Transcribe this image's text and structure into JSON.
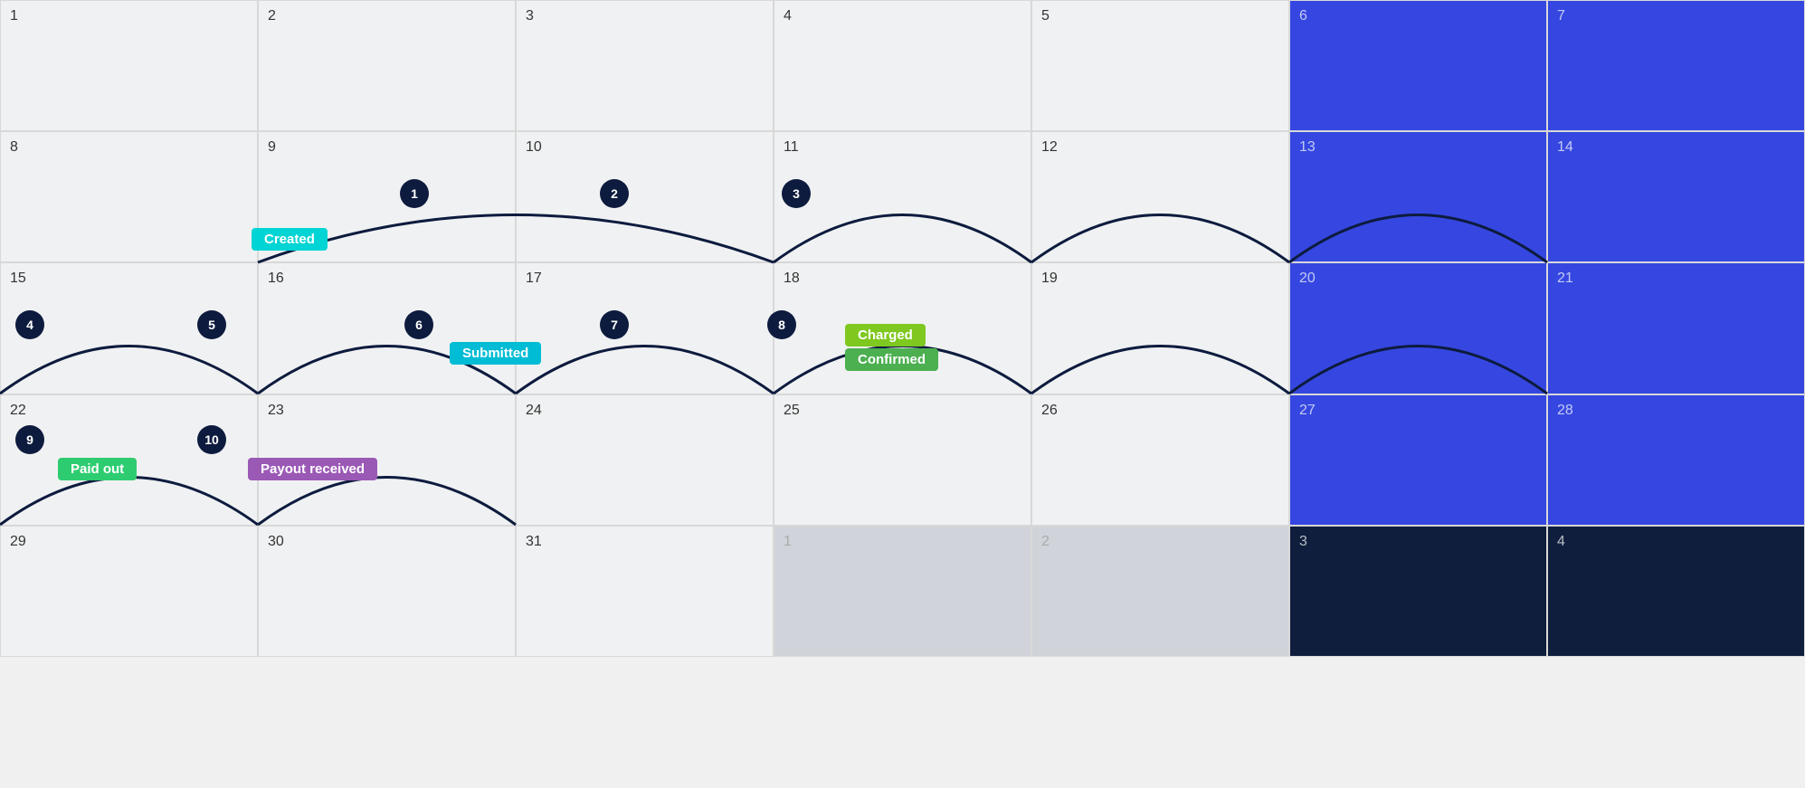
{
  "calendar": {
    "cells": [
      {
        "day": "1",
        "style": "normal",
        "col": 1,
        "row": 1
      },
      {
        "day": "2",
        "style": "normal",
        "col": 2,
        "row": 1
      },
      {
        "day": "3",
        "style": "normal",
        "col": 3,
        "row": 1
      },
      {
        "day": "4",
        "style": "normal",
        "col": 4,
        "row": 1
      },
      {
        "day": "5",
        "style": "normal",
        "col": 5,
        "row": 1
      },
      {
        "day": "6",
        "style": "blue-light",
        "col": 6,
        "row": 1
      },
      {
        "day": "7",
        "style": "blue-light",
        "col": 7,
        "row": 1
      },
      {
        "day": "8",
        "style": "normal",
        "col": 1,
        "row": 2
      },
      {
        "day": "9",
        "style": "normal",
        "col": 2,
        "row": 2
      },
      {
        "day": "10",
        "style": "normal",
        "col": 3,
        "row": 2
      },
      {
        "day": "11",
        "style": "normal",
        "col": 4,
        "row": 2
      },
      {
        "day": "12",
        "style": "normal",
        "col": 5,
        "row": 2
      },
      {
        "day": "13",
        "style": "blue-light",
        "col": 6,
        "row": 2
      },
      {
        "day": "14",
        "style": "blue-light",
        "col": 7,
        "row": 2
      },
      {
        "day": "15",
        "style": "normal",
        "col": 1,
        "row": 3
      },
      {
        "day": "16",
        "style": "normal",
        "col": 2,
        "row": 3
      },
      {
        "day": "17",
        "style": "normal",
        "col": 3,
        "row": 3
      },
      {
        "day": "18",
        "style": "normal",
        "col": 4,
        "row": 3
      },
      {
        "day": "19",
        "style": "normal",
        "col": 5,
        "row": 3
      },
      {
        "day": "20",
        "style": "blue-light",
        "col": 6,
        "row": 3
      },
      {
        "day": "21",
        "style": "blue-light",
        "col": 7,
        "row": 3
      },
      {
        "day": "22",
        "style": "normal",
        "col": 1,
        "row": 4
      },
      {
        "day": "23",
        "style": "normal",
        "col": 2,
        "row": 4
      },
      {
        "day": "24",
        "style": "normal",
        "col": 3,
        "row": 4
      },
      {
        "day": "25",
        "style": "normal",
        "col": 4,
        "row": 4
      },
      {
        "day": "26",
        "style": "normal",
        "col": 5,
        "row": 4
      },
      {
        "day": "27",
        "style": "blue-light",
        "col": 6,
        "row": 4
      },
      {
        "day": "28",
        "style": "blue-light",
        "col": 7,
        "row": 4
      },
      {
        "day": "29",
        "style": "normal",
        "col": 1,
        "row": 5
      },
      {
        "day": "30",
        "style": "normal",
        "col": 2,
        "row": 5
      },
      {
        "day": "31",
        "style": "normal",
        "col": 3,
        "row": 5
      },
      {
        "day": "1",
        "style": "gray-light",
        "col": 4,
        "row": 5
      },
      {
        "day": "2",
        "style": "gray-light",
        "col": 5,
        "row": 5
      },
      {
        "day": "3",
        "style": "dark-navy",
        "col": 6,
        "row": 5
      },
      {
        "day": "4",
        "style": "dark-navy",
        "col": 7,
        "row": 5
      }
    ],
    "labels": {
      "created": "Created",
      "submitted": "Submitted",
      "charged": "Charged",
      "confirmed": "Confirmed",
      "paid_out": "Paid out",
      "payout_received": "Payout received"
    }
  }
}
